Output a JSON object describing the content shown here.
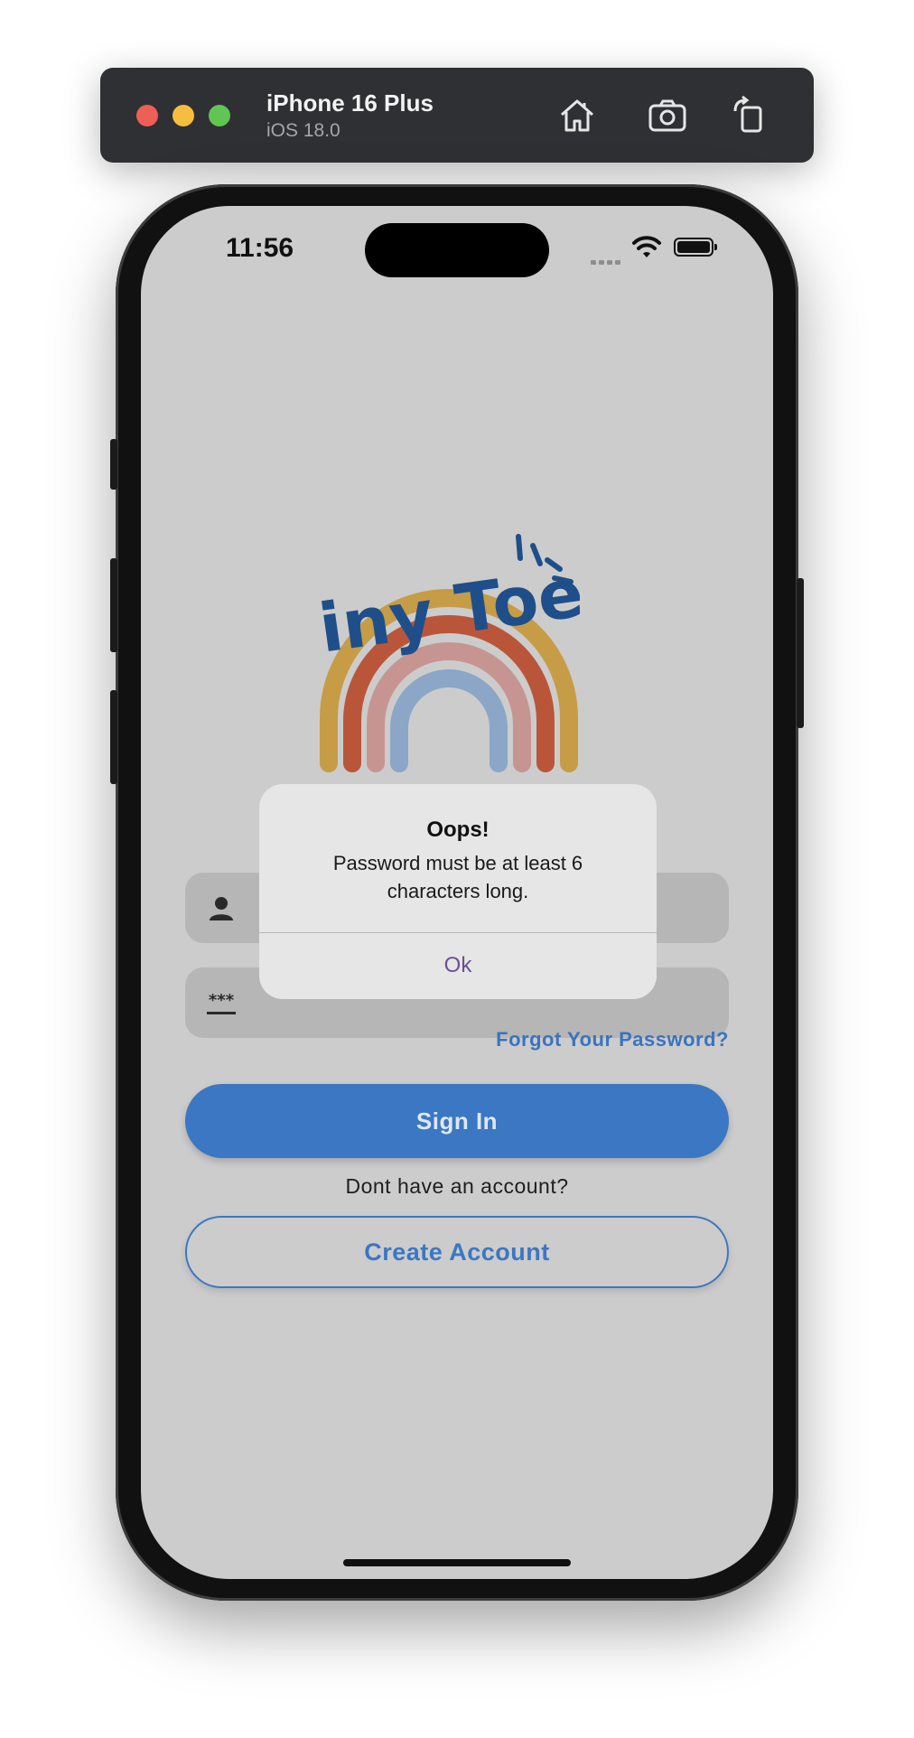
{
  "simulator": {
    "device_name": "iPhone 16 Plus",
    "os_version": "iOS 18.0",
    "toolbar_icons": [
      "home-icon",
      "screenshot-icon",
      "rotate-icon"
    ]
  },
  "status_bar": {
    "time": "11:56"
  },
  "app": {
    "logo_text": "Tiny Toes",
    "username_field": {
      "placeholder": "",
      "icon": "person-icon"
    },
    "password_field": {
      "placeholder": "",
      "icon": "password-icon"
    },
    "forgot_password_label": "Forgot Your Password?",
    "sign_in_label": "Sign In",
    "no_account_text": "Dont have an account?",
    "create_account_label": "Create Account"
  },
  "alert": {
    "title": "Oops!",
    "message": "Password must be at least 6 characters long.",
    "ok_label": "Ok"
  },
  "colors": {
    "primary": "#3b77c2",
    "logo_blue": "#1f4f8a",
    "alert_ok": "#6b4f97"
  }
}
